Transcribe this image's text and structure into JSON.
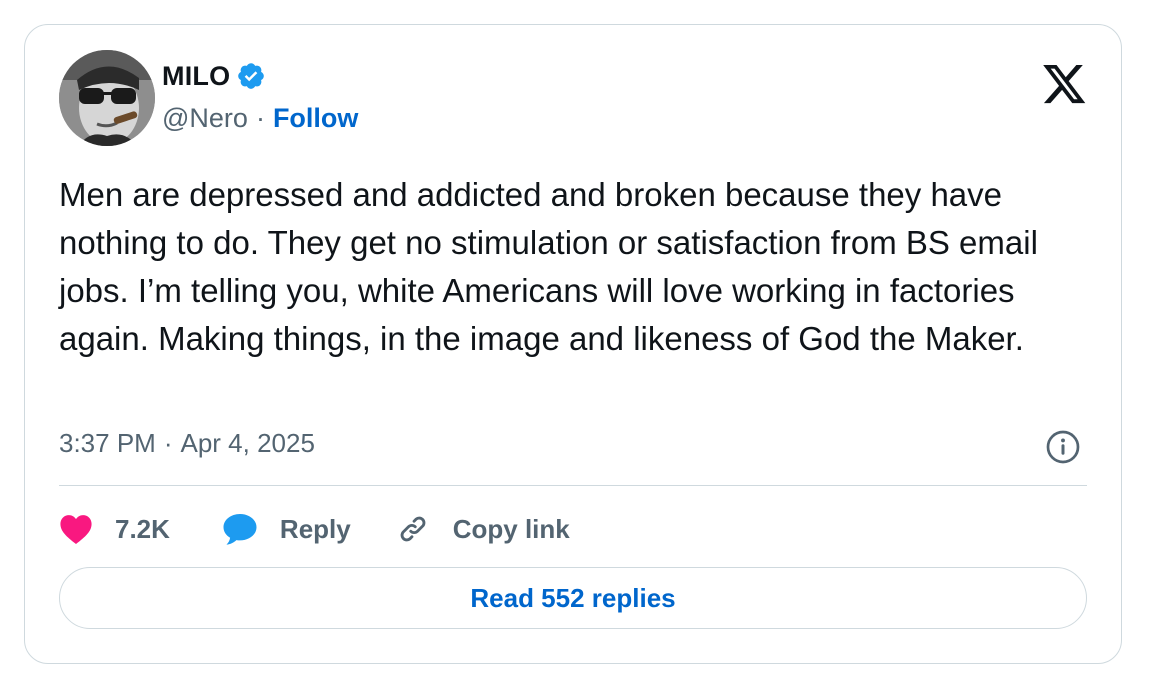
{
  "author": {
    "display_name": "MILO",
    "handle": "@Nero",
    "separator": "·",
    "follow_label": "Follow",
    "verified_color": "#1d9bf0"
  },
  "tweet": {
    "text": "Men are depressed and addicted and broken because they have nothing to do. They get no stimulation or satisfaction from BS email jobs. I’m telling you, white Americans will love working in factories again. Making things, in the image and likeness of God the Maker.",
    "time": "3:37 PM",
    "date_separator": "·",
    "date": "Apr 4, 2025"
  },
  "actions": {
    "likes": "7.2K",
    "reply_label": "Reply",
    "copy_link_label": "Copy link"
  },
  "read_replies": {
    "label": "Read 552 replies"
  },
  "icons": {
    "brand": "x-logo-icon",
    "info": "info-icon",
    "like": "heart-icon",
    "reply": "speech-bubble-icon",
    "copy": "link-icon",
    "verified": "verified-badge-icon"
  },
  "colors": {
    "text": "#0f1419",
    "secondary": "#536471",
    "link": "#0066cc",
    "heart": "#f91880",
    "reply": "#1d9bf0",
    "border": "#cfd9de"
  }
}
